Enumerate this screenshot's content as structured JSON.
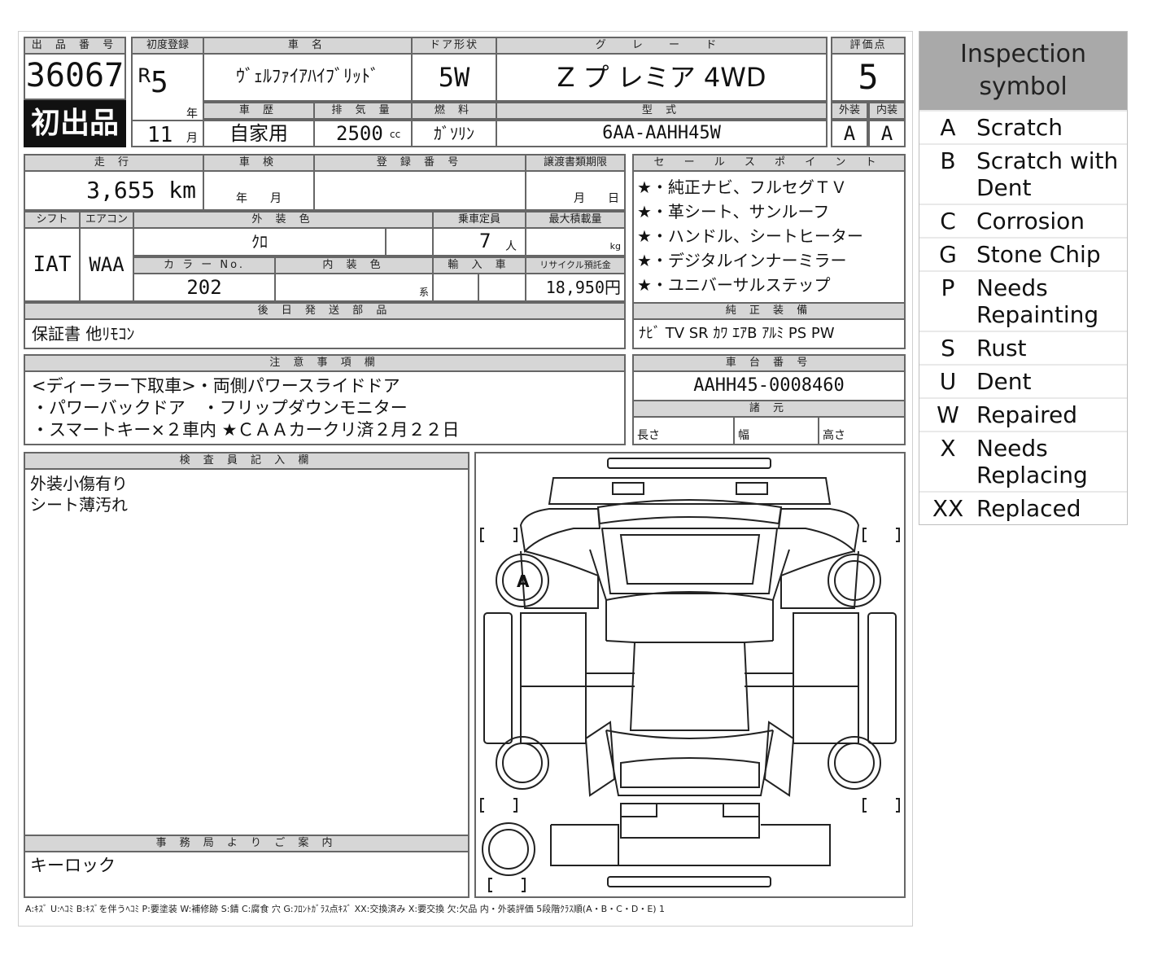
{
  "sheet": {
    "lot_header": "出 品 番 号",
    "lot_number": "36067",
    "first_listing": "初出品",
    "first_reg_header": "初度登録",
    "era": "R",
    "reg_year": "5",
    "year_unit": "年",
    "reg_month": "11",
    "month_unit": "月",
    "car_name_header": "車 名",
    "car_name": "ｳﾞｪﾙﾌｧｲｱﾊｲﾌﾞﾘｯﾄﾞ",
    "door_header": "ドア形状",
    "door_type": "5W",
    "grade_header": "グ レ ー ド",
    "grade": "Z プ レミア 4WD",
    "score_header": "評価点",
    "score": "5",
    "ext_header": "外装",
    "int_header": "内装",
    "ext_score": "A",
    "int_score": "A",
    "history_header": "車 歴",
    "history": "自家用",
    "displacement_header": "排 気 量",
    "displacement": "2500",
    "displacement_unit": "cc",
    "fuel_header": "燃 料",
    "fuel": "ｶﾞｿﾘﾝ",
    "model_header": "型 式",
    "model_code": "6AA-AAHH45W",
    "mileage_header": "走 行",
    "mileage": "3,655 km",
    "inspection_header": "車 検",
    "inspection_ym": "年　　月",
    "reg_no_header": "登 録 番 号",
    "transfer_header": "譲渡書類期限",
    "transfer_md": "月　　日",
    "shift_header": "シフト",
    "aircon_header": "エアコン",
    "shift": "IAT",
    "aircon": "WAA",
    "ext_color_header": "外 装 色",
    "ext_color": "ｸﾛ",
    "seating_header": "乗車定員",
    "seating": "7",
    "seating_unit": "人",
    "max_load_header": "最大積載量",
    "max_load_unit": "kg",
    "color_no_header": "カ ラ ー No.",
    "color_no": "202",
    "int_color_header": "内 装 色",
    "int_color_unit": "系",
    "import_header": "輸 入 車",
    "recycle_header": "リサイクル預託金",
    "recycle_fee": "18,950円",
    "later_parts_header": "後 日 発 送 部 品",
    "later_parts": "保証書 他ﾘﾓｺﾝ",
    "sales_header": "セ ー ル ス ポ イ ン ト",
    "sales_points": [
      "★・純正ナビ、フルセグＴＶ",
      "★・革シート、サンルーフ",
      "★・ハンドル、シートヒーター",
      "★・デジタルインナーミラー",
      "★・ユニバーサルステップ"
    ],
    "equip_header": "純 正 装 備",
    "equipment": "ﾅﾋﾞ TV SR ｶﾜ ｴｱB ｱﾙﾐ PS PW",
    "notes_header": "注 意 事 項 欄",
    "notes": [
      "<ディーラー下取車>・両側パワースライドドア",
      "・パワーバックドア　・フリップダウンモニター",
      "・スマートキー×２車内 ★ＣＡＡカークリ済２月２２日"
    ],
    "chassis_header": "車 台 番 号",
    "chassis_no": "AAHH45-0008460",
    "dims_header": "諸 元",
    "length_label": "長さ",
    "width_label": "幅",
    "height_label": "高さ",
    "inspector_header": "検 査 員 記 入 欄",
    "inspector_notes": [
      "外装小傷有り",
      "シート薄汚れ"
    ],
    "office_header": "事 務 局 よ り ご 案 内",
    "office_note": "キーロック",
    "diagram_mark": "A",
    "footer": "A:ｷｽﾞ U:ﾍｺﾐ B:ｷｽﾞを伴うﾍｺﾐ P:要塗装 W:補修跡 S:錆 C:腐食 穴 G:ﾌﾛﾝﾄｶﾞﾗｽ点ｷｽﾞ XX:交換済み X:要交換 欠:欠品 内・外装評価 5段階ｸﾗｽ順(A・B・C・D・E) 1"
  },
  "legend": {
    "title": "Inspection symbol",
    "items": [
      {
        "code": "A",
        "desc": "Scratch"
      },
      {
        "code": "B",
        "desc": "Scratch with Dent"
      },
      {
        "code": "C",
        "desc": "Corrosion"
      },
      {
        "code": "G",
        "desc": "Stone Chip"
      },
      {
        "code": "P",
        "desc": "Needs Repainting"
      },
      {
        "code": "S",
        "desc": "Rust"
      },
      {
        "code": "U",
        "desc": "Dent"
      },
      {
        "code": "W",
        "desc": "Repaired"
      },
      {
        "code": "X",
        "desc": "Needs Replacing"
      },
      {
        "code": "XX",
        "desc": "Replaced"
      }
    ]
  }
}
